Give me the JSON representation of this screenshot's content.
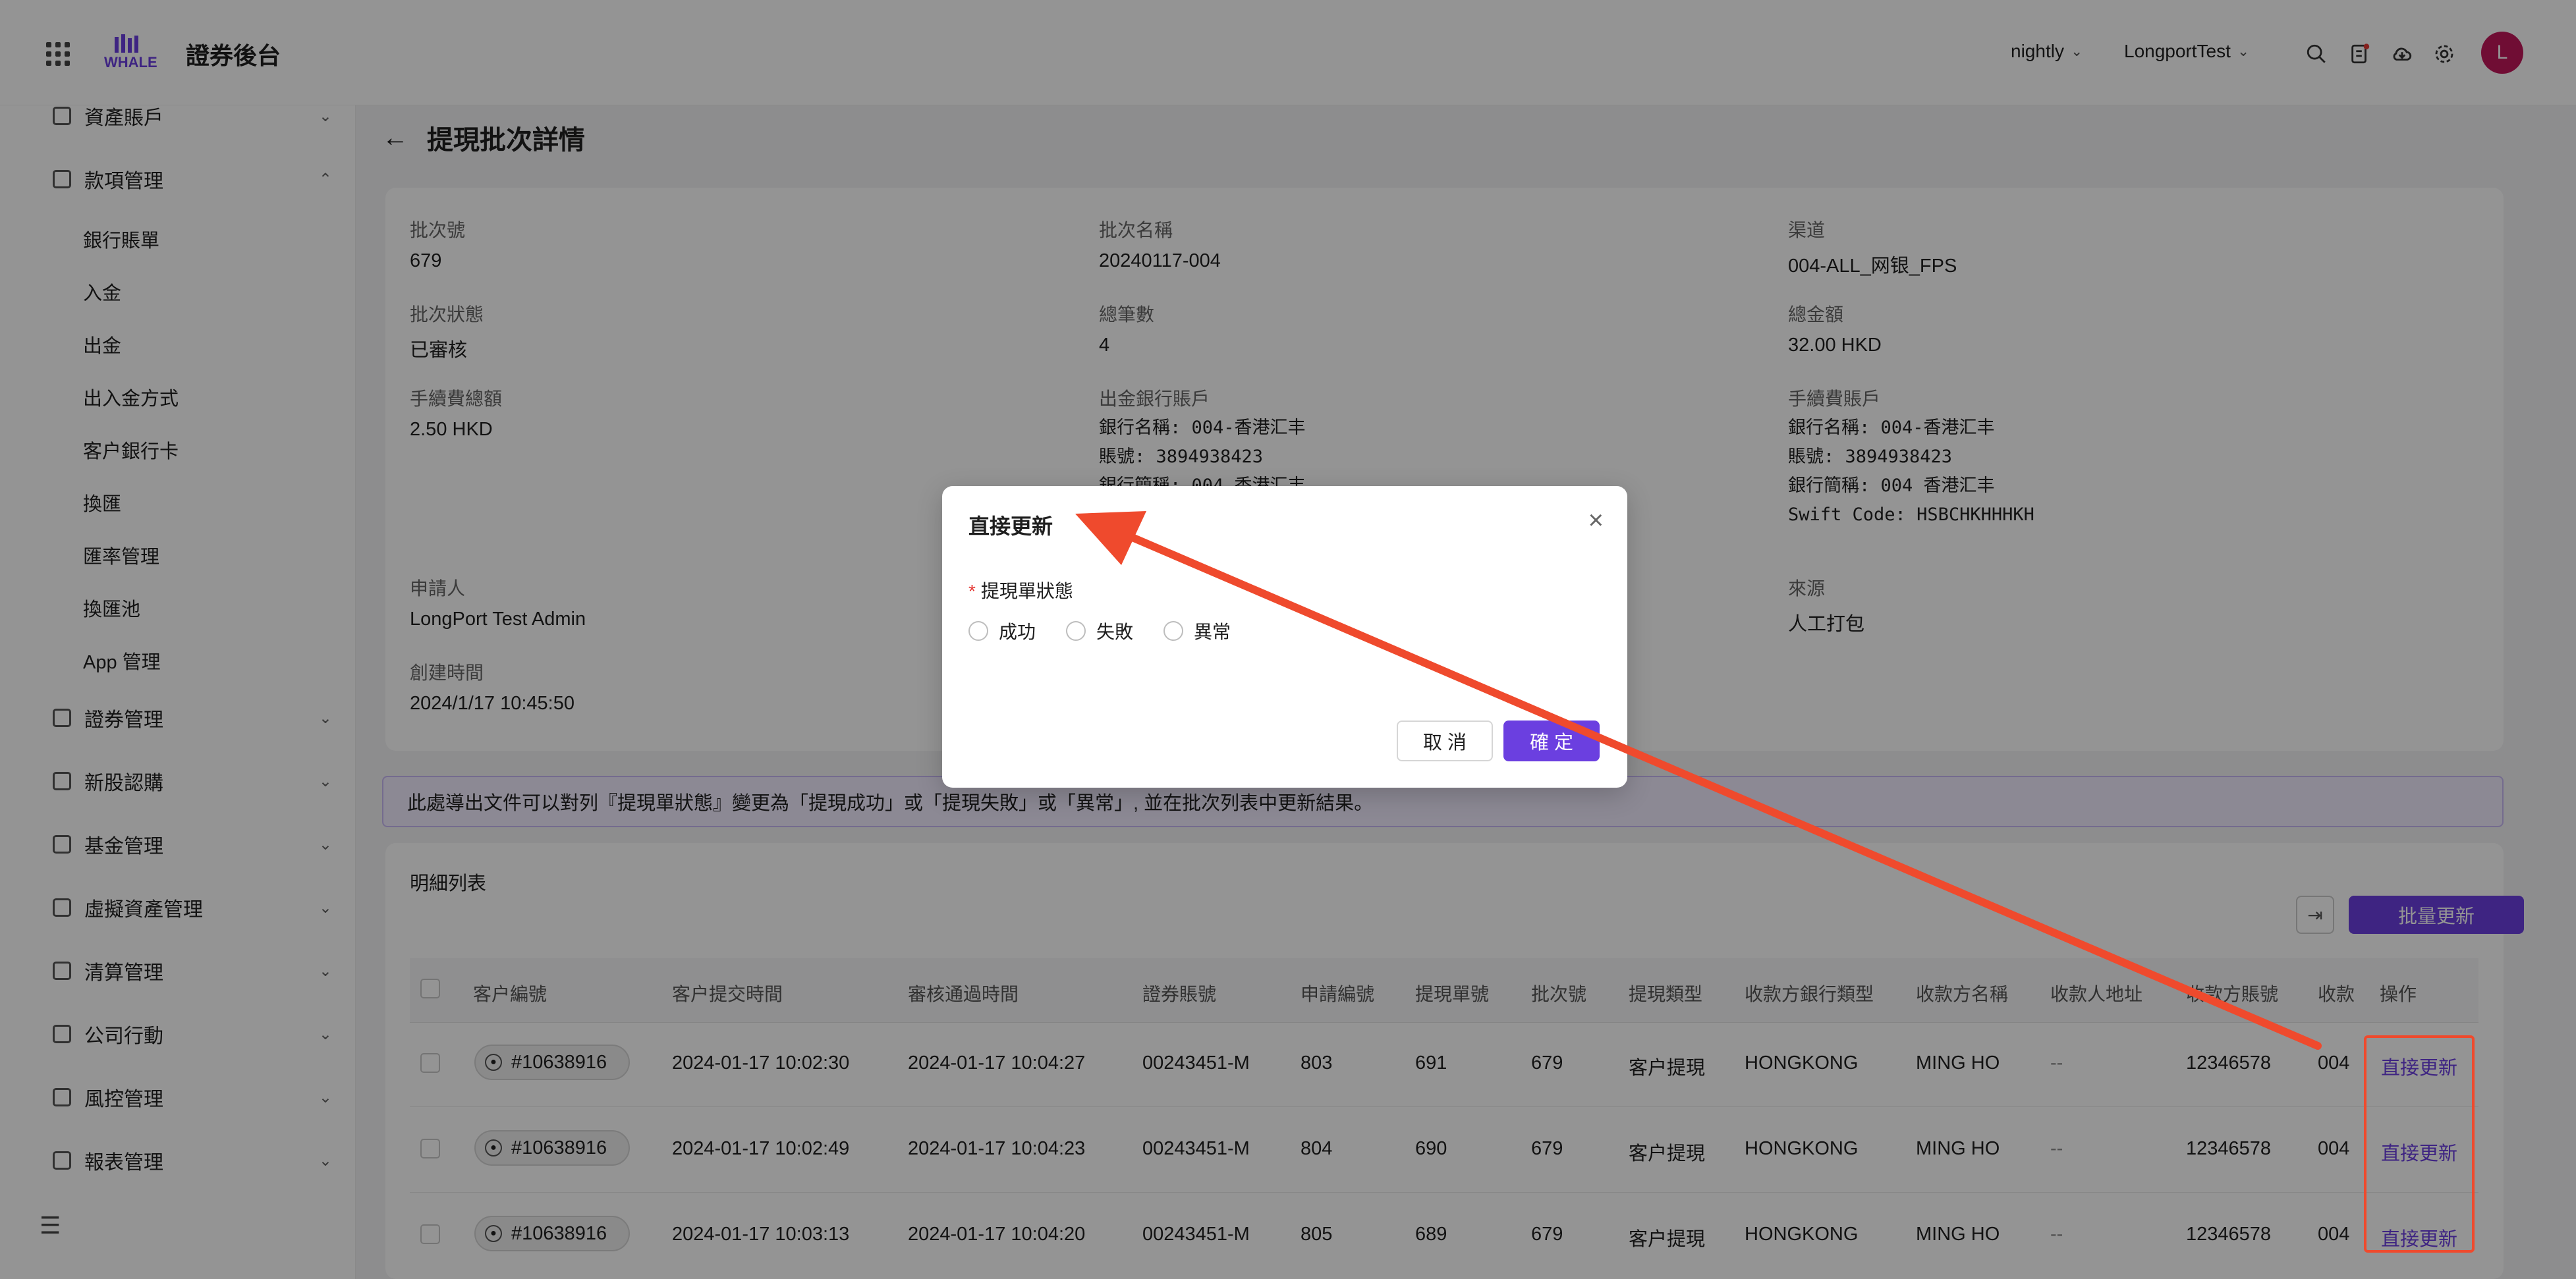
{
  "app": {
    "title": "證券後台",
    "logo_text": "WHALE"
  },
  "topbar": {
    "env": "nightly",
    "account": "LongportTest",
    "avatar_letter": "L",
    "icons": [
      "search-icon",
      "task-icon",
      "cloud-download-icon",
      "gear-icon"
    ]
  },
  "sidebar": {
    "menus": [
      {
        "label": "資產賬戶",
        "expanded": false
      },
      {
        "label": "款項管理",
        "expanded": true
      },
      {
        "label": "證券管理",
        "expanded": false
      },
      {
        "label": "新股認購",
        "expanded": false
      },
      {
        "label": "基金管理",
        "expanded": false
      },
      {
        "label": "虛擬資產管理",
        "expanded": false
      },
      {
        "label": "清算管理",
        "expanded": false
      },
      {
        "label": "公司行動",
        "expanded": false
      },
      {
        "label": "風控管理",
        "expanded": false
      },
      {
        "label": "報表管理",
        "expanded": false
      }
    ],
    "sub_items": [
      "銀行賬單",
      "入金",
      "出金",
      "出入金方式",
      "客户銀行卡",
      "換匯",
      "匯率管理",
      "換匯池",
      "App 管理"
    ]
  },
  "page": {
    "title": "提現批次詳情"
  },
  "details": {
    "batch_no_label": "批次號",
    "batch_no": "679",
    "batch_name_label": "批次名稱",
    "batch_name": "20240117-004",
    "channel_label": "渠道",
    "channel": "004-ALL_网银_FPS",
    "status_label": "批次狀態",
    "status": "已審核",
    "count_label": "總筆數",
    "count": "4",
    "total_label": "總金額",
    "total": "32.00 HKD",
    "fee_total_label": "手續費總額",
    "fee_total": "2.50 HKD",
    "out_account_label": "出金銀行賬戶",
    "out_account_lines": [
      "銀行名稱: 004-香港汇丰",
      "賬號: 3894938423",
      "銀行簡稱: 004 香港汇丰"
    ],
    "fee_account_label": "手續費賬戶",
    "fee_account_lines": [
      "銀行名稱: 004-香港汇丰",
      "賬號: 3894938423",
      "銀行簡稱: 004 香港汇丰",
      "Swift Code: HSBCHKHHHKH"
    ],
    "applicant_label": "申請人",
    "applicant": "LongPort Test Admin",
    "source_label": "來源",
    "source": "人工打包",
    "created_label": "創建時間",
    "created": "2024/1/17 10:45:50"
  },
  "notice": "此處導出文件可以對列『提現單狀態』變更為「提現成功」或「提現失敗」或「異常」, 並在批次列表中更新結果。",
  "list": {
    "title": "明細列表",
    "batch_update_label": "批量更新",
    "columns": [
      "客户編號",
      "客户提交時間",
      "審核通過時間",
      "證券賬號",
      "申請編號",
      "提現單號",
      "批次號",
      "提現類型",
      "收款方銀行類型",
      "收款方名稱",
      "收款人地址",
      "收款方賬號",
      "收款",
      "操作"
    ],
    "rows": [
      [
        "#10638916",
        "2024-01-17 10:02:30",
        "2024-01-17 10:04:27",
        "00243451-M",
        "803",
        "691",
        "679",
        "客户提現",
        "HONGKONG",
        "MING HO",
        "--",
        "12346578",
        "004",
        "直接更新"
      ],
      [
        "#10638916",
        "2024-01-17 10:02:49",
        "2024-01-17 10:04:23",
        "00243451-M",
        "804",
        "690",
        "679",
        "客户提現",
        "HONGKONG",
        "MING HO",
        "--",
        "12346578",
        "004",
        "直接更新"
      ],
      [
        "#10638916",
        "2024-01-17 10:03:13",
        "2024-01-17 10:04:20",
        "00243451-M",
        "805",
        "689",
        "679",
        "客户提現",
        "HONGKONG",
        "MING HO",
        "--",
        "12346578",
        "004",
        "直接更新"
      ]
    ]
  },
  "modal": {
    "title": "直接更新",
    "field_label": "提現單狀態",
    "options": [
      "成功",
      "失敗",
      "異常"
    ],
    "cancel_label": "取 消",
    "ok_label": "確 定"
  },
  "colors": {
    "primary": "#6b3fe0",
    "annotation": "#ef4a2d",
    "avatar": "#c2185b"
  }
}
